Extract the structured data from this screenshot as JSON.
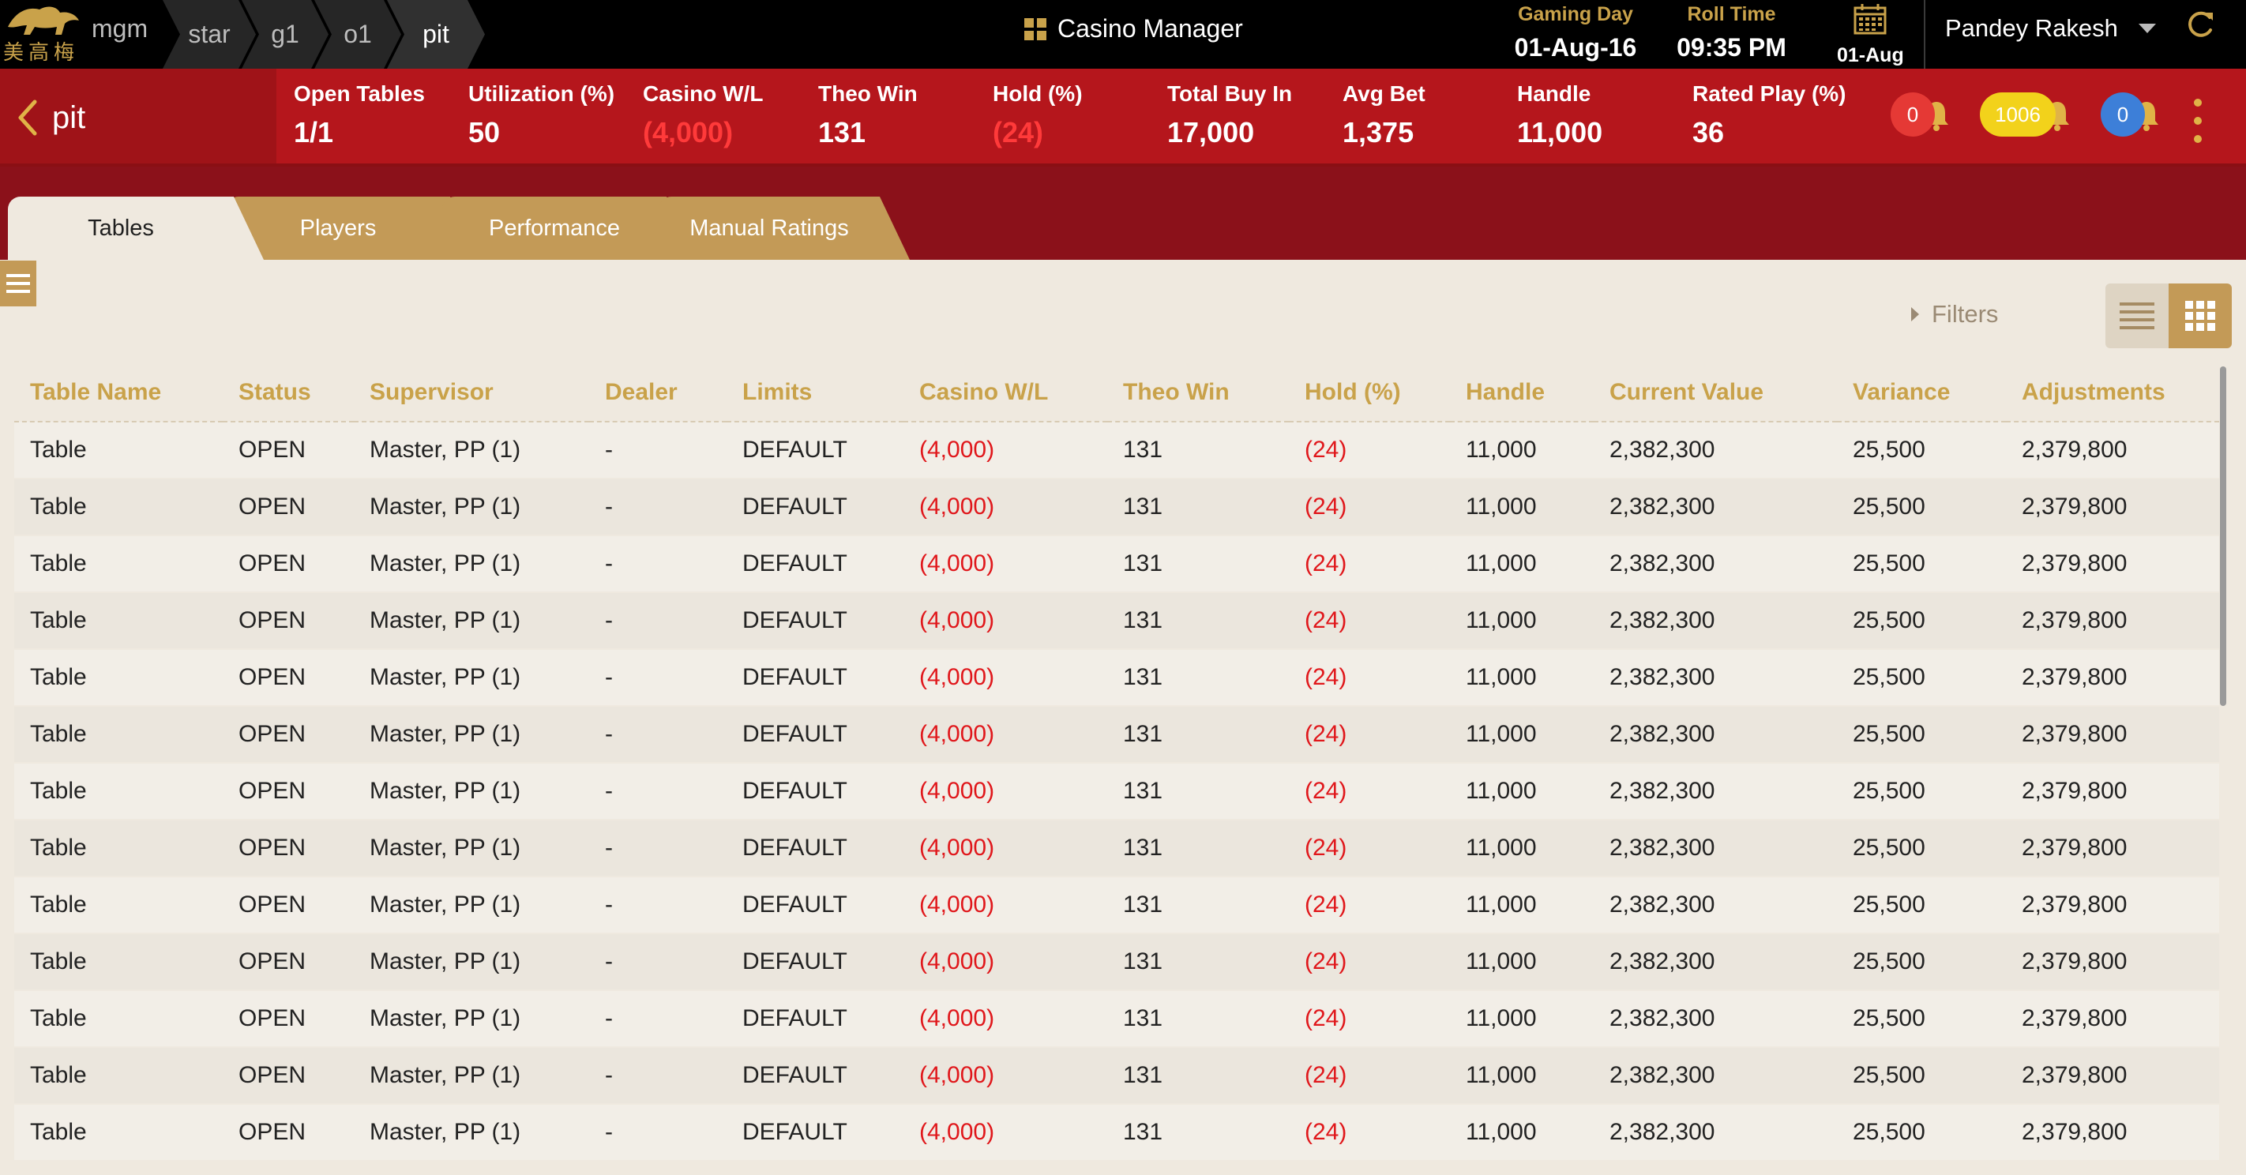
{
  "topbar": {
    "logo_text": "mgm",
    "logo_chars": "美高梅",
    "breadcrumbs": [
      "star",
      "g1",
      "o1",
      "pit"
    ],
    "app_title": "Casino Manager",
    "gaming_day_label": "Gaming Day",
    "gaming_day_value": "01-Aug-16",
    "roll_time_label": "Roll Time",
    "roll_time_value": "09:35 PM",
    "calendar_date": "01-Aug",
    "user_name": "Pandey Rakesh"
  },
  "statsbar": {
    "back_label": "pit",
    "stats": [
      {
        "label": "Open Tables",
        "value": "1/1",
        "negative": false
      },
      {
        "label": "Utilization (%)",
        "value": "50",
        "negative": false
      },
      {
        "label": "Casino W/L",
        "value": "(4,000)",
        "negative": true
      },
      {
        "label": "Theo Win",
        "value": "131",
        "negative": false
      },
      {
        "label": "Hold (%)",
        "value": "(24)",
        "negative": true
      },
      {
        "label": "Total Buy In",
        "value": "17,000",
        "negative": false
      },
      {
        "label": "Avg Bet",
        "value": "1,375",
        "negative": false
      },
      {
        "label": "Handle",
        "value": "11,000",
        "negative": false
      },
      {
        "label": "Rated Play (%)",
        "value": "36",
        "negative": false
      }
    ],
    "notifications": [
      {
        "count": "0",
        "color": "#e53935"
      },
      {
        "count": "1006",
        "color": "#f2d21b"
      },
      {
        "count": "0",
        "color": "#3d7fd8"
      }
    ]
  },
  "tabs": [
    "Tables",
    "Players",
    "Performance",
    "Manual Ratings"
  ],
  "active_tab": "Tables",
  "toolbar": {
    "filters_label": "Filters"
  },
  "table": {
    "columns": [
      "Table Name",
      "Status",
      "Supervisor",
      "Dealer",
      "Limits",
      "Casino W/L",
      "Theo Win",
      "Hold (%)",
      "Handle",
      "Current Value",
      "Variance",
      "Adjustments"
    ],
    "rows": [
      [
        "Table",
        "OPEN",
        "Master, PP (1)",
        "-",
        "DEFAULT",
        "(4,000)",
        "131",
        "(24)",
        "11,000",
        "2,382,300",
        "25,500",
        "2,379,800"
      ],
      [
        "Table",
        "OPEN",
        "Master, PP (1)",
        "-",
        "DEFAULT",
        "(4,000)",
        "131",
        "(24)",
        "11,000",
        "2,382,300",
        "25,500",
        "2,379,800"
      ],
      [
        "Table",
        "OPEN",
        "Master, PP (1)",
        "-",
        "DEFAULT",
        "(4,000)",
        "131",
        "(24)",
        "11,000",
        "2,382,300",
        "25,500",
        "2,379,800"
      ],
      [
        "Table",
        "OPEN",
        "Master, PP (1)",
        "-",
        "DEFAULT",
        "(4,000)",
        "131",
        "(24)",
        "11,000",
        "2,382,300",
        "25,500",
        "2,379,800"
      ],
      [
        "Table",
        "OPEN",
        "Master, PP (1)",
        "-",
        "DEFAULT",
        "(4,000)",
        "131",
        "(24)",
        "11,000",
        "2,382,300",
        "25,500",
        "2,379,800"
      ],
      [
        "Table",
        "OPEN",
        "Master, PP (1)",
        "-",
        "DEFAULT",
        "(4,000)",
        "131",
        "(24)",
        "11,000",
        "2,382,300",
        "25,500",
        "2,379,800"
      ],
      [
        "Table",
        "OPEN",
        "Master, PP (1)",
        "-",
        "DEFAULT",
        "(4,000)",
        "131",
        "(24)",
        "11,000",
        "2,382,300",
        "25,500",
        "2,379,800"
      ],
      [
        "Table",
        "OPEN",
        "Master, PP (1)",
        "-",
        "DEFAULT",
        "(4,000)",
        "131",
        "(24)",
        "11,000",
        "2,382,300",
        "25,500",
        "2,379,800"
      ],
      [
        "Table",
        "OPEN",
        "Master, PP (1)",
        "-",
        "DEFAULT",
        "(4,000)",
        "131",
        "(24)",
        "11,000",
        "2,382,300",
        "25,500",
        "2,379,800"
      ],
      [
        "Table",
        "OPEN",
        "Master, PP (1)",
        "-",
        "DEFAULT",
        "(4,000)",
        "131",
        "(24)",
        "11,000",
        "2,382,300",
        "25,500",
        "2,379,800"
      ],
      [
        "Table",
        "OPEN",
        "Master, PP (1)",
        "-",
        "DEFAULT",
        "(4,000)",
        "131",
        "(24)",
        "11,000",
        "2,382,300",
        "25,500",
        "2,379,800"
      ],
      [
        "Table",
        "OPEN",
        "Master, PP (1)",
        "-",
        "DEFAULT",
        "(4,000)",
        "131",
        "(24)",
        "11,000",
        "2,382,300",
        "25,500",
        "2,379,800"
      ],
      [
        "Table",
        "OPEN",
        "Master, PP (1)",
        "-",
        "DEFAULT",
        "(4,000)",
        "131",
        "(24)",
        "11,000",
        "2,382,300",
        "25,500",
        "2,379,800"
      ]
    ],
    "negative_columns": [
      5,
      7
    ]
  },
  "colors": {
    "header_bg": "#000000",
    "stats_bg": "#b5161c",
    "tab_strip_bg": "#8b111a",
    "accent_gold": "#c9a24a",
    "tab_bg": "#c39a57",
    "negative": "#e0171b",
    "content_bg": "#efe9df"
  },
  "icons": [
    "lion-logo-icon",
    "dashboard-grid-icon",
    "calendar-icon",
    "chevron-down-icon",
    "refresh-icon",
    "back-chevron-icon",
    "bell-icon",
    "more-vertical-icon",
    "menu-icon",
    "triangle-right-icon",
    "list-view-icon",
    "grid-view-icon"
  ]
}
